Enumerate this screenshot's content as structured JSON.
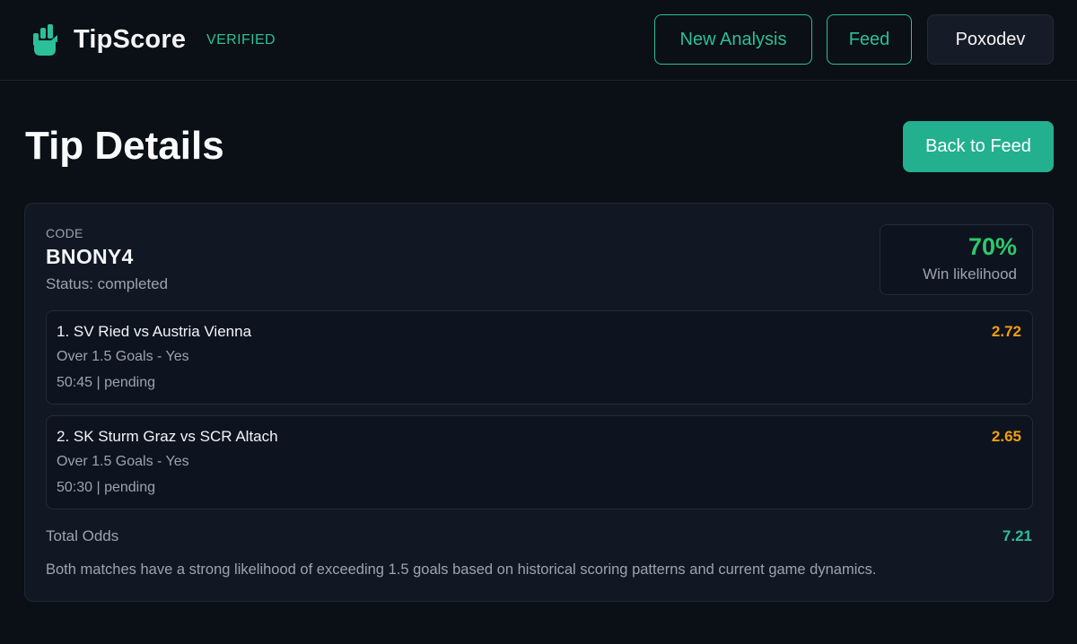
{
  "header": {
    "brand_name": "TipScore",
    "badge": "VERIFIED",
    "logo_icon": "hand-chart-icon",
    "nav": {
      "new_analysis": "New Analysis",
      "feed": "Feed",
      "user": "Poxodev"
    }
  },
  "page": {
    "title": "Tip Details",
    "back_button": "Back to Feed"
  },
  "tip": {
    "code_label": "CODE",
    "code": "BNONY4",
    "status": "Status: completed",
    "likelihood": "70%",
    "likelihood_label": "Win likelihood",
    "selections": [
      {
        "match": "1. SV Ried vs Austria Vienna",
        "market": "Over 1.5 Goals - Yes",
        "meta": "50:45 | pending",
        "odds": "2.72"
      },
      {
        "match": "2. SK Sturm Graz vs SCR Altach",
        "market": "Over 1.5 Goals - Yes",
        "meta": "50:30 | pending",
        "odds": "2.65"
      }
    ],
    "total_label": "Total Odds",
    "total_value": "7.21",
    "description": "Both matches have a strong likelihood of exceeding 1.5 goals based on historical scoring patterns and current game dynamics."
  },
  "colors": {
    "accent": "#2bbf9a",
    "background": "#0b0f16",
    "card": "#111723",
    "odds": "#f59e0b",
    "likelihood": "#2fc76b"
  }
}
